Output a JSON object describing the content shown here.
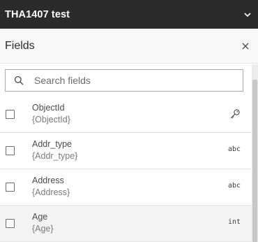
{
  "app": {
    "title": "THA1407 test"
  },
  "panel": {
    "title": "Fields"
  },
  "search": {
    "placeholder": "Search fields",
    "value": ""
  },
  "fields": [
    {
      "name": "ObjectId",
      "expr": "{ObjectId}",
      "type": "key-icon"
    },
    {
      "name": "Addr_type",
      "expr": "{Addr_type}",
      "type": "abc"
    },
    {
      "name": "Address",
      "expr": "{Address}",
      "type": "abc"
    },
    {
      "name": "Age",
      "expr": "{Age}",
      "type": "int"
    }
  ],
  "colors": {
    "topbar_bg": "#2b2b2b",
    "header_bg": "#f8f8f8",
    "row_hover_bg": "#f3f3f3"
  }
}
